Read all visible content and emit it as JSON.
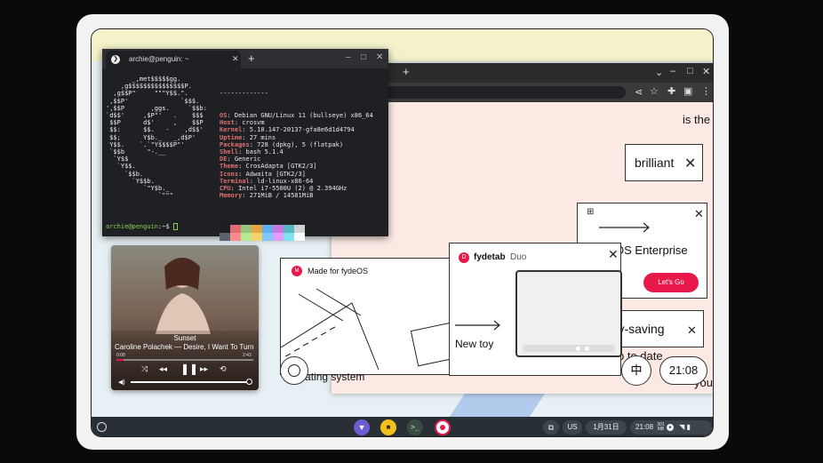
{
  "terminal": {
    "tab_title": "archie@penguin: ~",
    "new_tab": "+",
    "ascii_logo": "       _,met$$$$$gg.\n    ,g$$$$$$$$$$$$$$$P.\n  ,g$$P\"     \"\"\"Y$$.\".\n ,$$P'              `$$$.\n',$$P       ,ggs.     `$$b:\n`d$$'     ,$P\"'   .    $$$\n $$P      d$'     ,    $$P\n $$:      $$.   -    ,d$$'\n $$;      Y$b._   _,d$P'\n Y$$.    `.`\"Y$$$$P\"'\n `$$b      \"-.__\n  `Y$$\n   `Y$$.\n     `$$b.\n       `Y$$b.\n          `\"Y$b._\n              `\"\"\"",
    "separator": "-------------",
    "info": [
      {
        "key": "OS",
        "value": "Debian GNU/Linux 11 (bullseye) x86_64"
      },
      {
        "key": "Host",
        "value": "crosvm"
      },
      {
        "key": "Kernel",
        "value": "5.10.147-20137-gfa8e6d1d4794"
      },
      {
        "key": "Uptime",
        "value": "27 mins"
      },
      {
        "key": "Packages",
        "value": "728 (dpkg), 5 (flatpak)"
      },
      {
        "key": "Shell",
        "value": "bash 5.1.4"
      },
      {
        "key": "DE",
        "value": "Generic"
      },
      {
        "key": "Theme",
        "value": "CrosAdapta [GTK2/3]"
      },
      {
        "key": "Icons",
        "value": "Adwaita [GTK2/3]"
      },
      {
        "key": "Terminal",
        "value": "ld-linux-x86-64"
      },
      {
        "key": "CPU",
        "value": "Intel i7-5500U (2) @ 2.394GHz"
      },
      {
        "key": "Memory",
        "value": "271MiB / 14581MiB"
      }
    ],
    "palette_top": [
      "#1e1e1e",
      "#e06c75",
      "#98c379",
      "#e5a540",
      "#61afef",
      "#c678dd",
      "#56b6c2",
      "#d0d0d0"
    ],
    "palette_bottom": [
      "#5c6370",
      "#ff8a8a",
      "#b5e890",
      "#f5d36b",
      "#7ec8ff",
      "#e59cff",
      "#7fe3ee",
      "#ffffff"
    ],
    "prompt_user": "archie@penguin",
    "prompt_path": ":~$ "
  },
  "browser": {
    "new_tab": "+",
    "page": {
      "is_the": "is the",
      "brilliant": "brilliant",
      "enterprise": "OS Enterprise",
      "lets_go": "Let's Go",
      "energy_saving": "ery-saving",
      "up_to_date": "p to date",
      "made_for": "Made for fydeOS",
      "fydetab_brand": "fydetab",
      "fydetab_model": "Duo",
      "new_toy": "New toy",
      "operating_system": "operating system",
      "you": "you",
      "ime_label": "中",
      "clock_bubble": "21:08"
    }
  },
  "media": {
    "title": "Sunset",
    "subtitle": "Caroline Polachek — Desire, I Want To Turn Into You",
    "time_elapsed": "0:08",
    "time_total": "2:43",
    "progress": 0.05,
    "volume": 1.0
  },
  "shelf": {
    "ime": "US",
    "date": "1月31日",
    "time": "21:08",
    "notif_top": "301",
    "notif_bottom": "MB"
  },
  "colors": {
    "accent_red": "#e8194a",
    "shelf_bg": "#283036",
    "page_bg": "#fde9e4"
  }
}
